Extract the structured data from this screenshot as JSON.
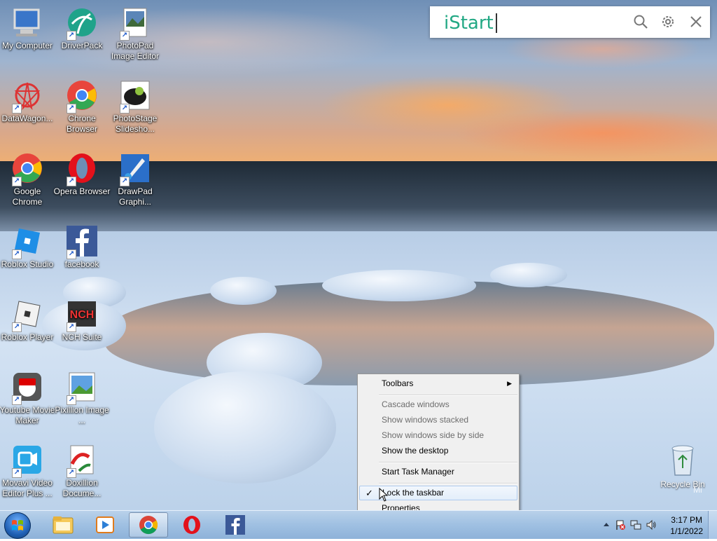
{
  "desktop": {
    "icons": [
      {
        "label": "My Computer",
        "name": "my-computer-icon"
      },
      {
        "label": "DriverPack",
        "name": "driverpack-icon"
      },
      {
        "label": "PhotoPad Image Editor",
        "name": "photopad-icon"
      },
      {
        "label": "DataWagon...",
        "name": "datawagon-icon"
      },
      {
        "label": "Chrone Browser",
        "name": "chrone-browser-icon"
      },
      {
        "label": "PhotoStage Slidesho...",
        "name": "photostage-icon"
      },
      {
        "label": "Google Chrome",
        "name": "google-chrome-icon"
      },
      {
        "label": "Opera Browser",
        "name": "opera-icon"
      },
      {
        "label": "DrawPad Graphi...",
        "name": "drawpad-icon"
      },
      {
        "label": "Roblox Studio",
        "name": "roblox-studio-icon"
      },
      {
        "label": "facebook",
        "name": "facebook-icon"
      },
      {
        "label": "Roblox Player",
        "name": "roblox-player-icon"
      },
      {
        "label": "NCH Suite",
        "name": "nch-suite-icon"
      },
      {
        "label": "Youtube Movie Maker",
        "name": "youtube-movie-maker-icon"
      },
      {
        "label": "Pixillion Image ...",
        "name": "pixillion-icon"
      },
      {
        "label": "Movavi Video Editor Plus ...",
        "name": "movavi-icon"
      },
      {
        "label": "Doxillion Docume...",
        "name": "doxillion-icon"
      }
    ],
    "recycle_bin": "Recycle Bin",
    "watermark": "Mi"
  },
  "istart": {
    "brand": "iStart",
    "value": "",
    "icons": [
      "search-icon",
      "gear-icon",
      "close-icon"
    ]
  },
  "context_menu": {
    "items": [
      {
        "label": "Toolbars",
        "enabled": true,
        "submenu": true
      },
      {
        "label": "Cascade windows",
        "enabled": false
      },
      {
        "label": "Show windows stacked",
        "enabled": false
      },
      {
        "label": "Show windows side by side",
        "enabled": false
      },
      {
        "label": "Show the desktop",
        "enabled": true
      },
      {
        "label": "Start Task Manager",
        "enabled": true
      },
      {
        "label": "Lock the taskbar",
        "enabled": true,
        "checked": true,
        "hover": true
      },
      {
        "label": "Properties",
        "enabled": true
      }
    ]
  },
  "taskbar": {
    "pinned": [
      "explorer-icon",
      "media-player-icon",
      "chrome-icon",
      "opera-icon",
      "facebook-icon"
    ],
    "active": "chrome-icon",
    "clock_time": "3:17 PM",
    "clock_date": "1/1/2022"
  },
  "colors": {
    "istart_brand": "#22a884",
    "taskbar": "#9fc0e2",
    "menu_bg": "#f0f0f0"
  }
}
